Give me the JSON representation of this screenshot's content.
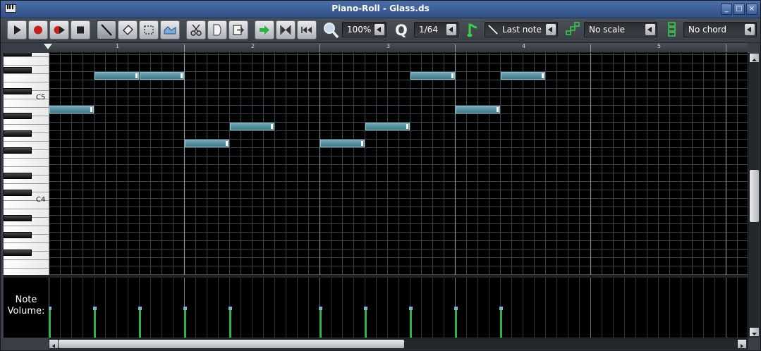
{
  "window": {
    "title": "Piano-Roll - Glass.ds",
    "buttons": [
      "_",
      "□",
      "×"
    ]
  },
  "toolbar": {
    "tools": [
      {
        "name": "play-button",
        "icon": "play-icon"
      },
      {
        "name": "record-button",
        "icon": "record-icon"
      },
      {
        "name": "record-while-playing-button",
        "icon": "record-play-icon"
      },
      {
        "name": "stop-button",
        "icon": "stop-icon"
      },
      {
        "name": "draw-mode-button",
        "icon": "pencil-icon",
        "active": true
      },
      {
        "name": "erase-mode-button",
        "icon": "eraser-icon"
      },
      {
        "name": "select-mode-button",
        "icon": "select-rectangle-icon"
      },
      {
        "name": "detune-mode-button",
        "icon": "automation-icon"
      },
      {
        "name": "cut-button",
        "icon": "scissors-icon"
      },
      {
        "name": "copy-button",
        "icon": "copy-icon"
      },
      {
        "name": "paste-button",
        "icon": "paste-icon"
      },
      {
        "name": "step-forward-button",
        "icon": "arrow-right-icon"
      },
      {
        "name": "loop-markers-button",
        "icon": "loop-icon"
      },
      {
        "name": "rewind-button",
        "icon": "rewind-icon"
      }
    ],
    "zoom": "100%",
    "quantize": "1/64",
    "note_length": "Last note",
    "scale": "No scale",
    "chord": "No chord"
  },
  "timeline": {
    "bars": [
      "1",
      "2",
      "3",
      "4",
      "5"
    ]
  },
  "keyboard": {
    "labels": [
      "C5",
      "C4"
    ]
  },
  "notes": [
    {
      "step": 0,
      "length": 4,
      "row": 6
    },
    {
      "step": 4,
      "length": 4,
      "row": 2
    },
    {
      "step": 8,
      "length": 4,
      "row": 2
    },
    {
      "step": 12,
      "length": 4,
      "row": 10
    },
    {
      "step": 16,
      "length": 4,
      "row": 8
    },
    {
      "step": 24,
      "length": 4,
      "row": 10
    },
    {
      "step": 28,
      "length": 4,
      "row": 8
    },
    {
      "step": 32,
      "length": 4,
      "row": 2
    },
    {
      "step": 36,
      "length": 4,
      "row": 6
    },
    {
      "step": 40,
      "length": 4,
      "row": 2
    }
  ],
  "volume": {
    "label_line1": "Note",
    "label_line2": "Volume:",
    "levels": [
      1,
      1,
      1,
      1,
      1,
      1,
      1,
      1,
      1,
      1
    ]
  },
  "colors": {
    "note_fill": "#5f97a4",
    "volume_bar": "#2bb04a",
    "grid_line": "#3d4146",
    "grid_bar_line": "#8a8f96"
  }
}
